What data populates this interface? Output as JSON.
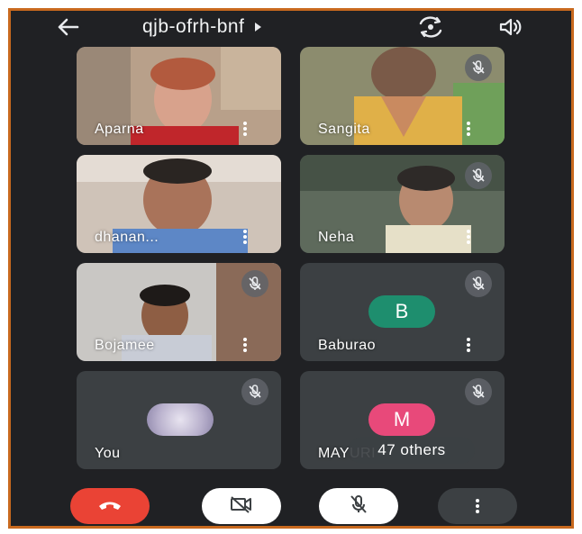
{
  "meeting": {
    "code": "qjb-ofrh-bnf"
  },
  "participants": [
    {
      "name": "Aparna"
    },
    {
      "name": "Sangita"
    },
    {
      "name": "dhanan..."
    },
    {
      "name": "Neha"
    },
    {
      "name": "Bojamee"
    },
    {
      "name": "Baburao",
      "initial": "B",
      "avatar_color": "#1e8e6e"
    },
    {
      "name": "You"
    },
    {
      "name": "MAYURI",
      "initial": "M",
      "avatar_color": "#e8497a"
    }
  ],
  "others_label": "47 others",
  "controls": [
    "end-call",
    "camera-off",
    "mic-off",
    "more-options"
  ],
  "colors": {
    "background": "#202124",
    "tile": "#3c4043",
    "hangup": "#ea4335",
    "border": "#c8691e"
  }
}
